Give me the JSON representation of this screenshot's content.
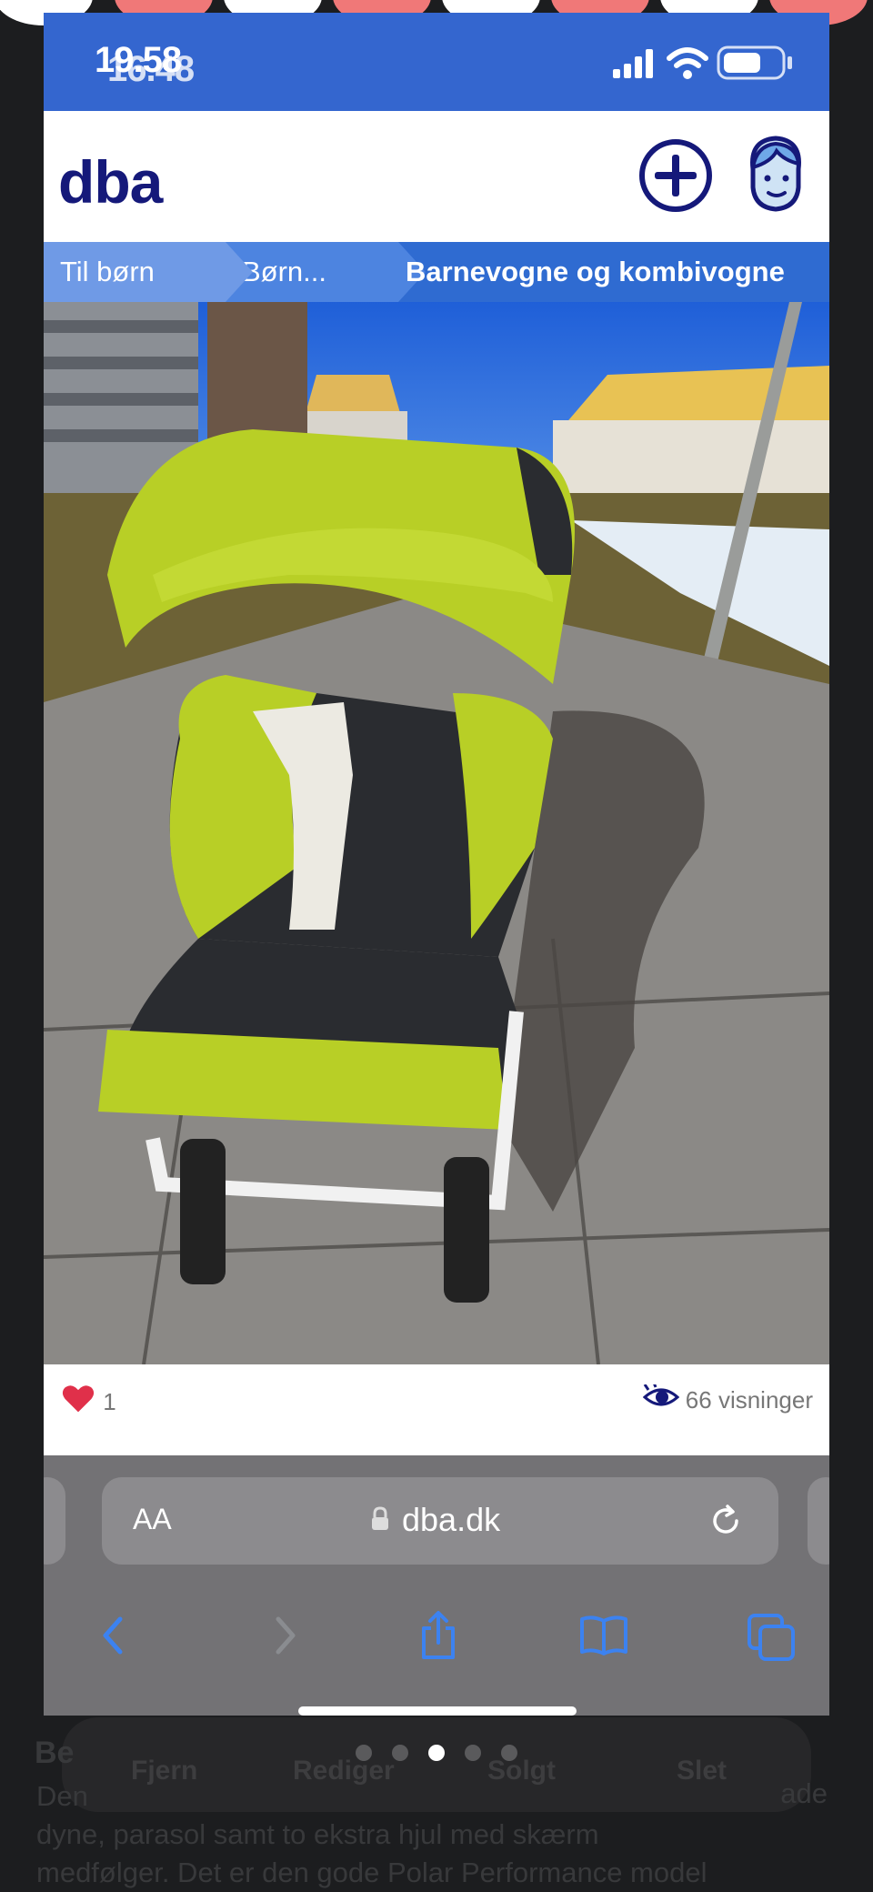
{
  "status": {
    "time": "19.58",
    "time_ghost": "16.48"
  },
  "header": {
    "logo": "dba"
  },
  "breadcrumb": [
    {
      "label": "Til børn"
    },
    {
      "label": "Børn..."
    },
    {
      "label": "Barnevogne og kombivogne"
    }
  ],
  "stats": {
    "likes": "1",
    "views": "66 visninger"
  },
  "browser": {
    "aa": "AA",
    "domain": "dba.dk"
  },
  "background_page": {
    "dock_labels": [
      "Fjern",
      "Rediger",
      "Solgt",
      "Slet"
    ],
    "heading_fragment": "Be",
    "right_fragment": "ade",
    "text_lines": [
      "Den",
      "dyne, parasol samt to ekstra hjul med skærm",
      "medfølger. Det er den gode Polar Performance model"
    ]
  },
  "colors": {
    "brand": "#15197a",
    "status_bar": "#3466cf",
    "heart": "#e0304a"
  }
}
